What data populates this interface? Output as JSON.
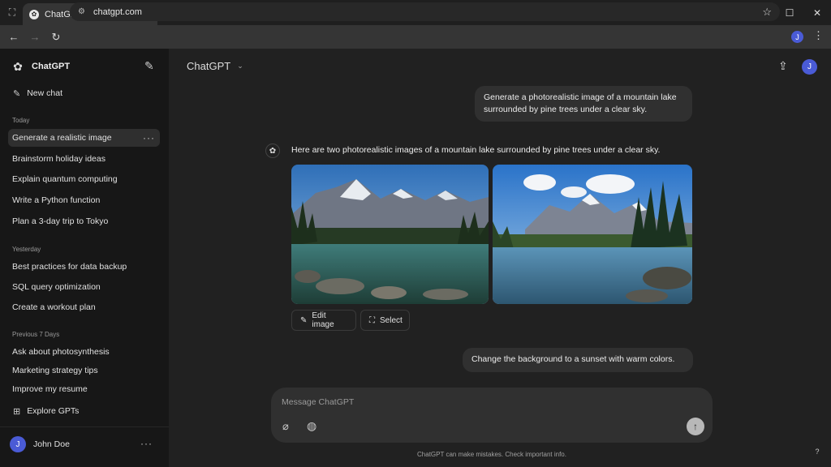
{
  "browser": {
    "tab_title": "ChatGPT",
    "tab_close": "✕",
    "new_tab": "+",
    "url": "chatgpt.com",
    "profile_initial": "J",
    "window_controls": {
      "minimize": "—",
      "maximize": "☐",
      "close": "✕"
    }
  },
  "sidebar": {
    "title": "ChatGPT",
    "new_chat": "New chat",
    "sections": [
      {
        "label": "Today",
        "items": [
          "Generate a realistic image",
          "Brainstorm holiday ideas",
          "Explain quantum computing",
          "Write a Python function",
          "Plan a 3-day trip to Tokyo"
        ]
      },
      {
        "label": "Yesterday",
        "items": [
          "Best practices for data backup",
          "SQL query optimization",
          "Create a workout plan"
        ]
      },
      {
        "label": "Previous 7 Days",
        "items": [
          "Ask about photosynthesis",
          "Marketing strategy tips",
          "Improve my resume"
        ]
      }
    ],
    "active_item_more": "···",
    "explore": "Explore GPTs",
    "user": {
      "initial": "J",
      "name": "John Doe",
      "more": "···"
    }
  },
  "main": {
    "model": "ChatGPT",
    "avatar_initial": "J",
    "messages": {
      "user1": "Generate a photorealistic image of a mountain lake surrounded by pine trees under a clear sky.",
      "assistant1": "Here are two photorealistic images of a mountain lake surrounded by pine trees under a clear sky.",
      "user2": "Change the background to a sunset with warm colors."
    },
    "image_actions": {
      "edit": "Edit image",
      "select": "Select"
    },
    "composer": {
      "placeholder": "Message ChatGPT"
    },
    "disclaimer": "ChatGPT can make mistakes. Check important info.",
    "help": "?"
  },
  "colors": {
    "accent_avatar": "#4a5bd6",
    "sidebar_bg": "#171717",
    "main_bg": "#212121",
    "bubble_bg": "#303030"
  }
}
